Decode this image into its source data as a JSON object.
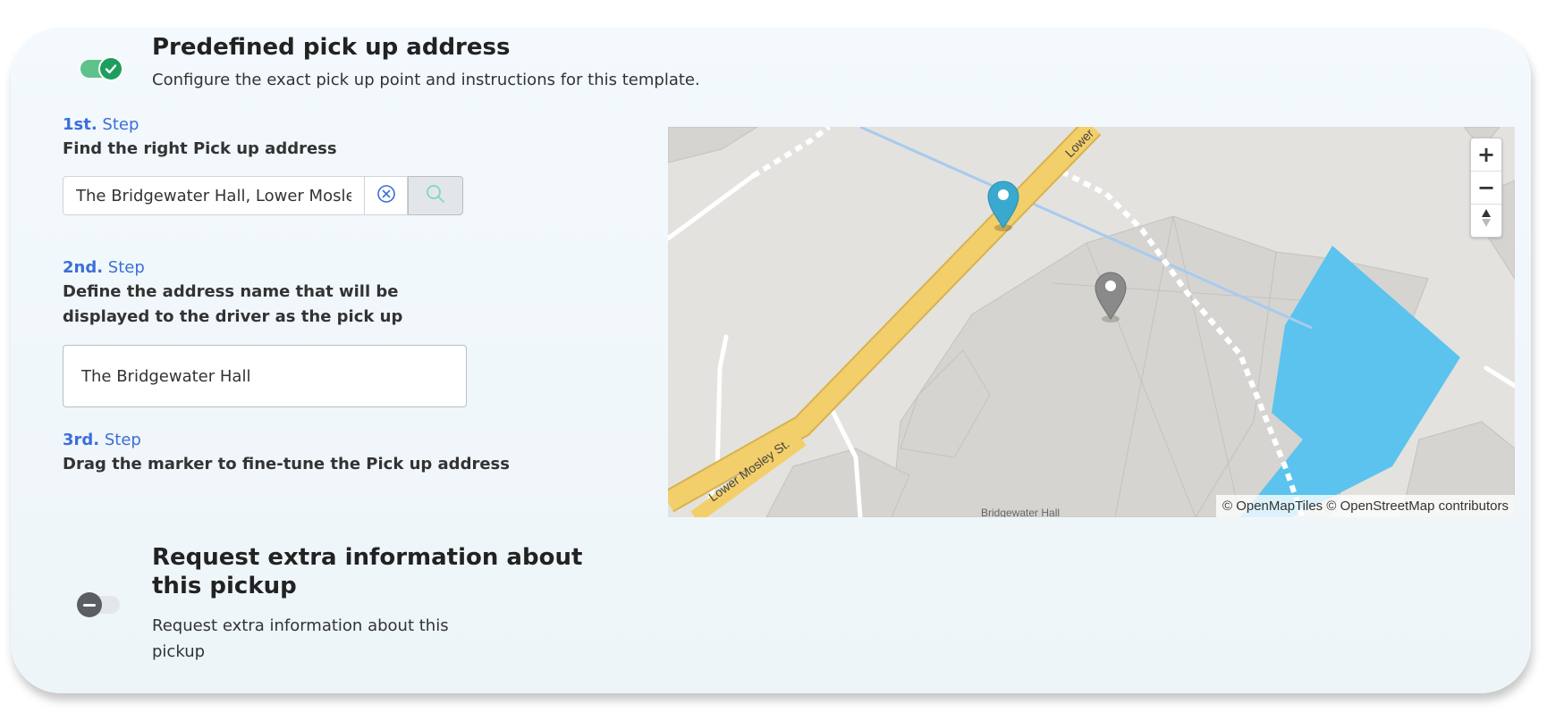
{
  "pickup": {
    "title": "Predefined pick up address",
    "description": "Configure the exact pick up point and instructions for this template.",
    "enabled": true
  },
  "steps": [
    {
      "ordinal": "1st.",
      "word": "Step",
      "text": "Find the right Pick up address"
    },
    {
      "ordinal": "2nd.",
      "word": "Step",
      "text": "Define the address name that will be displayed to the driver as the pick up"
    },
    {
      "ordinal": "3rd.",
      "word": "Step",
      "text": "Drag the marker to fine-tune the Pick up address"
    }
  ],
  "search": {
    "value": "The Bridgewater Hall, Lower Mosley St, Manchester",
    "clear_icon": "clear-circle-icon",
    "search_icon": "search-icon"
  },
  "address_name": {
    "value": "The Bridgewater Hall"
  },
  "map": {
    "labels": {
      "street": "Lower Mosley St.",
      "street_top": "Lower",
      "building": "Bridgewater Hall"
    },
    "zoom_in": "+",
    "zoom_out": "−",
    "attribution": "© OpenMapTiles © OpenStreetMap contributors",
    "colors": {
      "road": "#f2cf6a",
      "water": "#5bc3ee",
      "marker_active": "#3aa9cf",
      "marker_inactive": "#8a8a8a"
    }
  },
  "extra": {
    "title": "Request extra information about this pickup",
    "description": "Request extra information about this pickup",
    "enabled": false
  },
  "colors": {
    "accent": "#3b6fd8",
    "toggle_on": "#1f9d5e"
  }
}
